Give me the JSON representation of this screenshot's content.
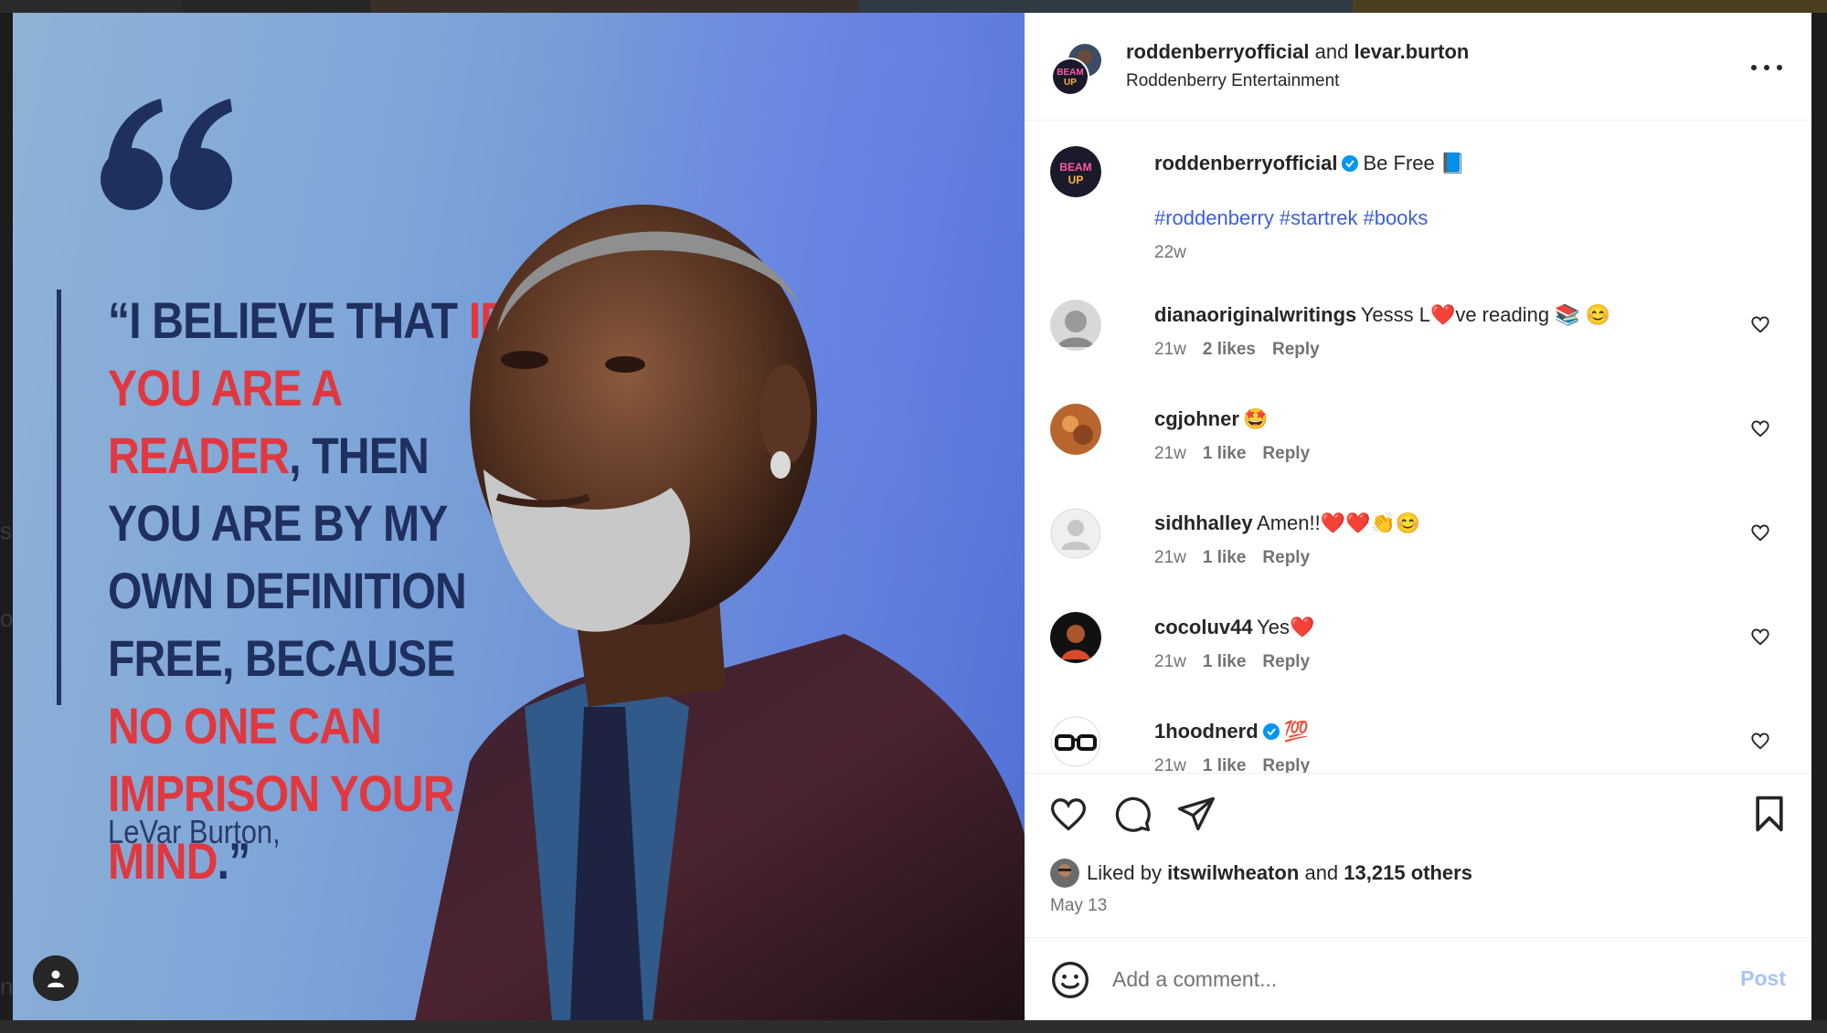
{
  "header": {
    "primary_user": "roddenberryofficial",
    "conjunction": "and",
    "secondary_user": "levar.burton",
    "subtitle": "Roddenberry Entertainment",
    "avatar_text": "BEAM UP"
  },
  "image": {
    "quote_plain_1": "“I BELIEVE THAT ",
    "quote_red_1": "IF YOU ARE A READER",
    "quote_plain_2": ", THEN YOU ARE BY MY OWN DEFINITION FREE, BECAUSE ",
    "quote_red_2": "NO ONE CAN IMPRISON YOUR MIND",
    "quote_plain_3": ".”",
    "author": "LeVar Burton,"
  },
  "caption": {
    "username": "roddenberryofficial",
    "text": "Be Free 📘",
    "hashtags": [
      "#roddenberry",
      "#startrek",
      "#books"
    ],
    "age": "22w"
  },
  "comments": [
    {
      "username": "dianaoriginalwritings",
      "verified": false,
      "text": "Yesss L❤️ve reading 📚 😊",
      "age": "21w",
      "likes": "2 likes",
      "reply": "Reply"
    },
    {
      "username": "cgjohner",
      "verified": false,
      "text": "🤩",
      "age": "21w",
      "likes": "1 like",
      "reply": "Reply"
    },
    {
      "username": "sidhhalley",
      "verified": false,
      "text": "Amen!!❤️❤️👏😊",
      "age": "21w",
      "likes": "1 like",
      "reply": "Reply"
    },
    {
      "username": "cocoluv44",
      "verified": false,
      "text": "Yes❤️",
      "age": "21w",
      "likes": "1 like",
      "reply": "Reply"
    },
    {
      "username": "1hoodnerd",
      "verified": true,
      "text": "💯",
      "age": "21w",
      "likes": "1 like",
      "reply": "Reply"
    }
  ],
  "likes": {
    "prefix": "Liked by",
    "user": "itswilwheaton",
    "conjunction": "and",
    "others": "13,215 others"
  },
  "post_date": "May 13",
  "add_comment": {
    "placeholder": "Add a comment...",
    "post_label": "Post"
  },
  "colors": {
    "link": "#3b5ee0",
    "verified": "#0095f6",
    "quote_red": "#e0383e",
    "quote_navy": "#1f2f5e"
  },
  "icons": [
    "user-tag-icon",
    "more-options-icon",
    "verified-badge-icon",
    "heart-icon",
    "comment-icon",
    "share-icon",
    "bookmark-icon",
    "emoji-icon"
  ]
}
